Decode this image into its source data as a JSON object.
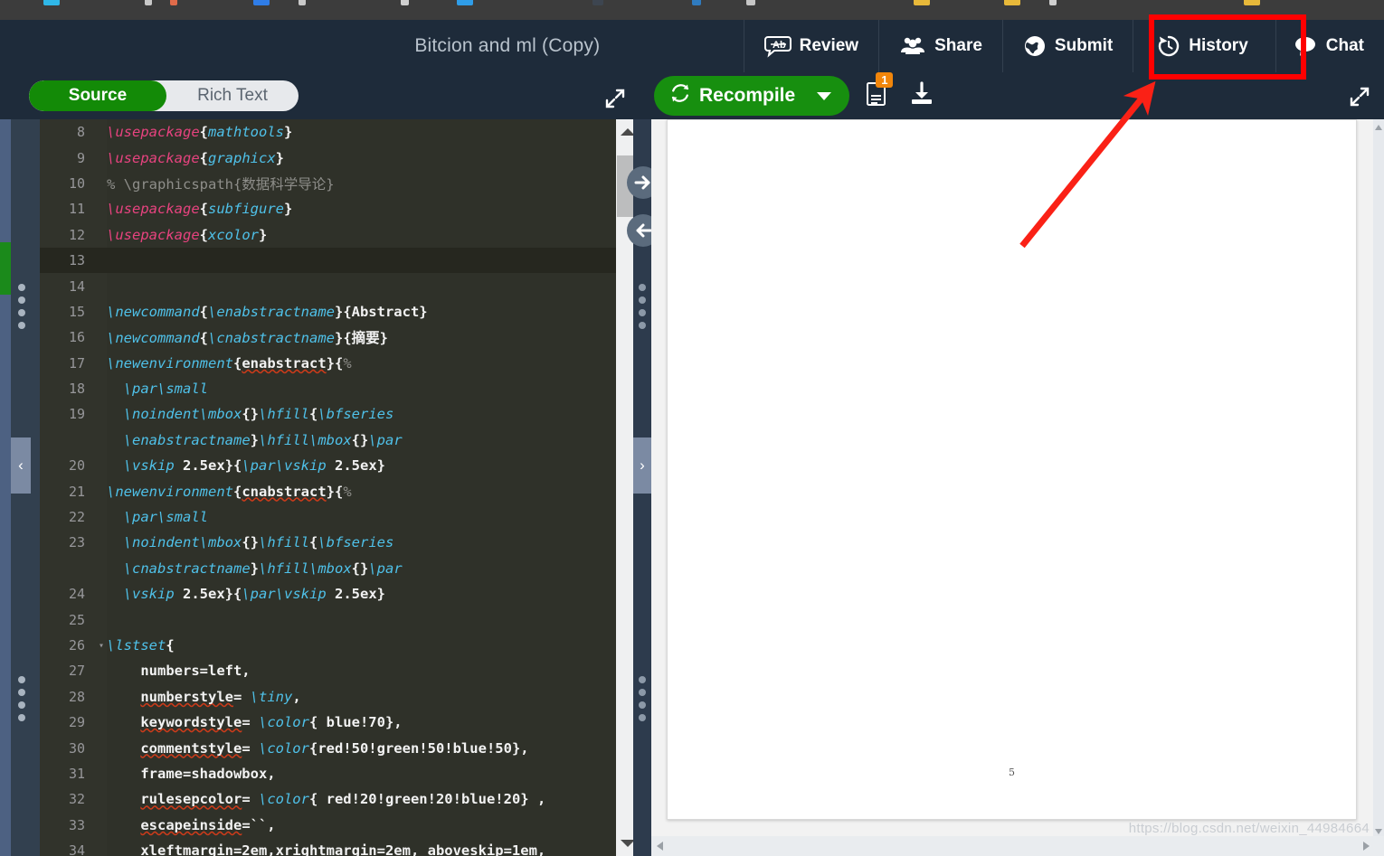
{
  "window": {
    "bookmarks_strip_visible": true
  },
  "header": {
    "doc_title": "Bitcion and ml (Copy)",
    "actions": [
      {
        "label": "Review",
        "icon": "review-icon"
      },
      {
        "label": "Share",
        "icon": "share-users-icon"
      },
      {
        "label": "Submit",
        "icon": "submit-globe-icon"
      },
      {
        "label": "History",
        "icon": "history-clock-icon"
      },
      {
        "label": "Chat",
        "icon": "chat-bubble-icon"
      }
    ]
  },
  "editor_toolbar": {
    "mode_source": "Source",
    "mode_richtext": "Rich Text",
    "active_mode": "Source",
    "expand_icon": "expand-arrows-icon"
  },
  "pdf_toolbar": {
    "recompile_label": "Recompile",
    "recompile_icon": "refresh-icon",
    "dropdown_icon": "chevron-down-icon",
    "logs_icon": "compile-log-icon",
    "logs_badge": "1",
    "download_icon": "download-pdf-icon",
    "expand_icon": "expand-arrows-icon"
  },
  "editor": {
    "active_line": 13,
    "first_visible_line": 8,
    "lines": [
      {
        "n": "8",
        "fold": "",
        "tokens": [
          {
            "t": "\\usepackage",
            "c": "cmd"
          },
          {
            "t": "{",
            "c": "plain"
          },
          {
            "t": "mathtools",
            "c": "pkg"
          },
          {
            "t": "}",
            "c": "plain"
          }
        ]
      },
      {
        "n": "9",
        "fold": "",
        "tokens": [
          {
            "t": "\\usepackage",
            "c": "cmd"
          },
          {
            "t": "{",
            "c": "plain"
          },
          {
            "t": "graphicx",
            "c": "pkg"
          },
          {
            "t": "}",
            "c": "plain"
          }
        ]
      },
      {
        "n": "10",
        "fold": "",
        "tokens": [
          {
            "t": "% \\graphicspath{数据科学导论}",
            "c": "cmt"
          }
        ]
      },
      {
        "n": "11",
        "fold": "",
        "tokens": [
          {
            "t": "\\usepackage",
            "c": "cmd"
          },
          {
            "t": "{",
            "c": "plain"
          },
          {
            "t": "subfigure",
            "c": "pkg"
          },
          {
            "t": "}",
            "c": "plain"
          }
        ]
      },
      {
        "n": "12",
        "fold": "",
        "tokens": [
          {
            "t": "\\usepackage",
            "c": "cmd"
          },
          {
            "t": "{",
            "c": "plain"
          },
          {
            "t": "xcolor",
            "c": "pkg"
          },
          {
            "t": "}",
            "c": "plain"
          }
        ]
      },
      {
        "n": "13",
        "fold": "",
        "tokens": []
      },
      {
        "n": "14",
        "fold": "",
        "tokens": []
      },
      {
        "n": "15",
        "fold": "",
        "tokens": [
          {
            "t": "\\newcommand",
            "c": "blue"
          },
          {
            "t": "{",
            "c": "plain"
          },
          {
            "t": "\\enabstractname",
            "c": "blue"
          },
          {
            "t": "}{Abstract}",
            "c": "plain"
          }
        ]
      },
      {
        "n": "16",
        "fold": "",
        "tokens": [
          {
            "t": "\\newcommand",
            "c": "blue"
          },
          {
            "t": "{",
            "c": "plain"
          },
          {
            "t": "\\cnabstractname",
            "c": "blue"
          },
          {
            "t": "}{摘要}",
            "c": "plain"
          }
        ]
      },
      {
        "n": "17",
        "fold": "",
        "tokens": [
          {
            "t": "\\newenvironment",
            "c": "blue"
          },
          {
            "t": "{",
            "c": "plain"
          },
          {
            "t": "enabstract",
            "c": "spellplain"
          },
          {
            "t": "}{",
            "c": "plain"
          },
          {
            "t": "%",
            "c": "cmt"
          }
        ]
      },
      {
        "n": "18",
        "fold": "",
        "tokens": [
          {
            "t": "  ",
            "c": "plain"
          },
          {
            "t": "\\par\\small",
            "c": "blue"
          }
        ]
      },
      {
        "n": "19",
        "fold": "",
        "tokens": [
          {
            "t": "  ",
            "c": "plain"
          },
          {
            "t": "\\noindent\\mbox",
            "c": "blue"
          },
          {
            "t": "{}",
            "c": "plain"
          },
          {
            "t": "\\hfill",
            "c": "blue"
          },
          {
            "t": "{",
            "c": "plain"
          },
          {
            "t": "\\bfseries",
            "c": "blue"
          }
        ]
      },
      {
        "n": "",
        "fold": "",
        "tokens": [
          {
            "t": "  ",
            "c": "plain"
          },
          {
            "t": "\\enabstractname",
            "c": "blue"
          },
          {
            "t": "}",
            "c": "plain"
          },
          {
            "t": "\\hfill\\mbox",
            "c": "blue"
          },
          {
            "t": "{}",
            "c": "plain"
          },
          {
            "t": "\\par",
            "c": "blue"
          }
        ]
      },
      {
        "n": "20",
        "fold": "",
        "tokens": [
          {
            "t": "  ",
            "c": "plain"
          },
          {
            "t": "\\vskip",
            "c": "blue"
          },
          {
            "t": " 2.5ex}{",
            "c": "plain"
          },
          {
            "t": "\\par\\vskip",
            "c": "blue"
          },
          {
            "t": " 2.5ex}",
            "c": "plain"
          }
        ]
      },
      {
        "n": "21",
        "fold": "",
        "tokens": [
          {
            "t": "\\newenvironment",
            "c": "blue"
          },
          {
            "t": "{",
            "c": "plain"
          },
          {
            "t": "cnabstract",
            "c": "spellplain"
          },
          {
            "t": "}{",
            "c": "plain"
          },
          {
            "t": "%",
            "c": "cmt"
          }
        ]
      },
      {
        "n": "22",
        "fold": "",
        "tokens": [
          {
            "t": "  ",
            "c": "plain"
          },
          {
            "t": "\\par\\small",
            "c": "blue"
          }
        ]
      },
      {
        "n": "23",
        "fold": "",
        "tokens": [
          {
            "t": "  ",
            "c": "plain"
          },
          {
            "t": "\\noindent\\mbox",
            "c": "blue"
          },
          {
            "t": "{}",
            "c": "plain"
          },
          {
            "t": "\\hfill",
            "c": "blue"
          },
          {
            "t": "{",
            "c": "plain"
          },
          {
            "t": "\\bfseries",
            "c": "blue"
          }
        ]
      },
      {
        "n": "",
        "fold": "",
        "tokens": [
          {
            "t": "  ",
            "c": "plain"
          },
          {
            "t": "\\cnabstractname",
            "c": "blue"
          },
          {
            "t": "}",
            "c": "plain"
          },
          {
            "t": "\\hfill\\mbox",
            "c": "blue"
          },
          {
            "t": "{}",
            "c": "plain"
          },
          {
            "t": "\\par",
            "c": "blue"
          }
        ]
      },
      {
        "n": "24",
        "fold": "",
        "tokens": [
          {
            "t": "  ",
            "c": "plain"
          },
          {
            "t": "\\vskip",
            "c": "blue"
          },
          {
            "t": " 2.5ex}{",
            "c": "plain"
          },
          {
            "t": "\\par\\vskip",
            "c": "blue"
          },
          {
            "t": " 2.5ex}",
            "c": "plain"
          }
        ]
      },
      {
        "n": "25",
        "fold": "",
        "tokens": []
      },
      {
        "n": "26",
        "fold": "▾",
        "tokens": [
          {
            "t": "\\lstset",
            "c": "blue"
          },
          {
            "t": "{",
            "c": "plain"
          }
        ]
      },
      {
        "n": "27",
        "fold": "",
        "tokens": [
          {
            "t": "    numbers=left,",
            "c": "plain"
          }
        ]
      },
      {
        "n": "28",
        "fold": "",
        "tokens": [
          {
            "t": "    ",
            "c": "plain"
          },
          {
            "t": "numberstyle",
            "c": "spellplain"
          },
          {
            "t": "= ",
            "c": "plain"
          },
          {
            "t": "\\tiny",
            "c": "blue"
          },
          {
            "t": ",",
            "c": "plain"
          }
        ]
      },
      {
        "n": "29",
        "fold": "",
        "tokens": [
          {
            "t": "    ",
            "c": "plain"
          },
          {
            "t": "keywordstyle",
            "c": "spellplain"
          },
          {
            "t": "= ",
            "c": "plain"
          },
          {
            "t": "\\color",
            "c": "blue"
          },
          {
            "t": "{ blue!70},",
            "c": "plain"
          }
        ]
      },
      {
        "n": "30",
        "fold": "",
        "tokens": [
          {
            "t": "    ",
            "c": "plain"
          },
          {
            "t": "commentstyle",
            "c": "spellplain"
          },
          {
            "t": "= ",
            "c": "plain"
          },
          {
            "t": "\\color",
            "c": "blue"
          },
          {
            "t": "{red!50!green!50!blue!50},",
            "c": "plain"
          }
        ]
      },
      {
        "n": "31",
        "fold": "",
        "tokens": [
          {
            "t": "    frame=shadowbox,",
            "c": "plain"
          }
        ]
      },
      {
        "n": "32",
        "fold": "",
        "tokens": [
          {
            "t": "    ",
            "c": "plain"
          },
          {
            "t": "rulesepcolor",
            "c": "spellplain"
          },
          {
            "t": "= ",
            "c": "plain"
          },
          {
            "t": "\\color",
            "c": "blue"
          },
          {
            "t": "{ red!20!green!20!blue!20} ,",
            "c": "plain"
          }
        ]
      },
      {
        "n": "33",
        "fold": "",
        "tokens": [
          {
            "t": "    ",
            "c": "plain"
          },
          {
            "t": "escapeinside",
            "c": "spellplain"
          },
          {
            "t": "=``,",
            "c": "plain"
          }
        ]
      },
      {
        "n": "34",
        "fold": "",
        "tokens": [
          {
            "t": "    xleftmargin=2em,xrightmargin=2em, aboveskip=1em,",
            "c": "plain"
          }
        ]
      }
    ]
  },
  "pdf": {
    "page_number": "5",
    "scroll_left_icon": "scroll-left-arrow",
    "scroll_right_icon": "scroll-right-arrow"
  },
  "splitter": {
    "sync_to_pdf_icon": "arrow-right-circle-icon",
    "sync_to_code_icon": "arrow-left-circle-icon"
  },
  "annotations": {
    "highlight_target": "History",
    "box_color": "#ff0000",
    "arrow_color": "#fa2116"
  },
  "watermark": {
    "text": "https://blog.csdn.net/weixin_44984664"
  }
}
